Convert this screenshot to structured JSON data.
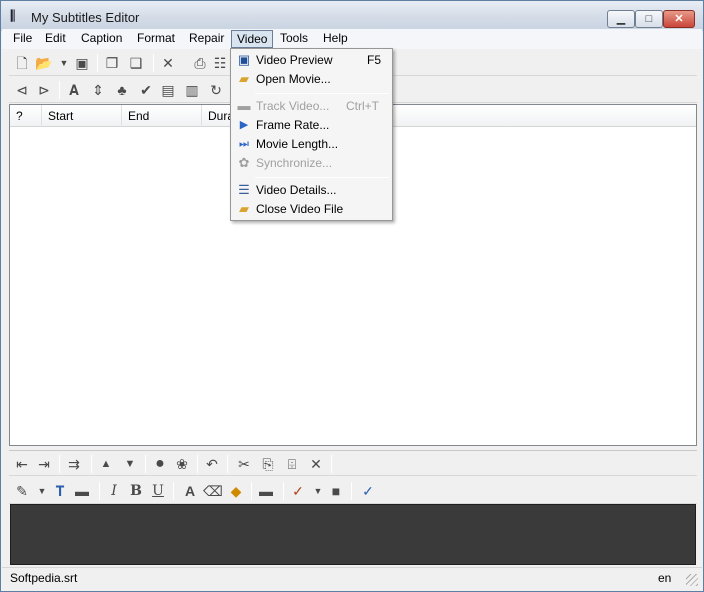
{
  "window": {
    "title": "My Subtitles Editor"
  },
  "menubar": {
    "items": [
      {
        "label": "File"
      },
      {
        "label": "Edit"
      },
      {
        "label": "Caption"
      },
      {
        "label": "Format"
      },
      {
        "label": "Repair"
      },
      {
        "label": "Video"
      },
      {
        "label": "Tools"
      },
      {
        "label": "Help"
      }
    ]
  },
  "table": {
    "columns": [
      {
        "label": "?"
      },
      {
        "label": "Start"
      },
      {
        "label": "End"
      },
      {
        "label": "Dura"
      }
    ]
  },
  "video_menu": {
    "items": [
      {
        "label": "Video Preview",
        "shortcut": "F5",
        "icon": "video-preview-icon",
        "enabled": true
      },
      {
        "label": "Open Movie...",
        "shortcut": "",
        "icon": "open-folder-icon",
        "enabled": true
      },
      {
        "label": "Track Video...",
        "shortcut": "Ctrl+T",
        "icon": "track-video-icon",
        "enabled": false
      },
      {
        "label": "Frame Rate...",
        "shortcut": "",
        "icon": "play-arrow-icon",
        "enabled": true
      },
      {
        "label": "Movie Length...",
        "shortcut": "",
        "icon": "skip-end-icon",
        "enabled": true
      },
      {
        "label": "Synchronize...",
        "shortcut": "",
        "icon": "synchronize-icon",
        "enabled": false
      },
      {
        "label": "Video Details...",
        "shortcut": "",
        "icon": "document-icon",
        "enabled": true
      },
      {
        "label": "Close Video File",
        "shortcut": "",
        "icon": "close-folder-icon",
        "enabled": true
      }
    ]
  },
  "statusbar": {
    "filename": "Softpedia.srt",
    "language": "en"
  },
  "colors": {
    "menu_highlight": "#d9e4f1",
    "editor_background": "#3a3a3a",
    "disabled_text": "#a0a0a0"
  }
}
